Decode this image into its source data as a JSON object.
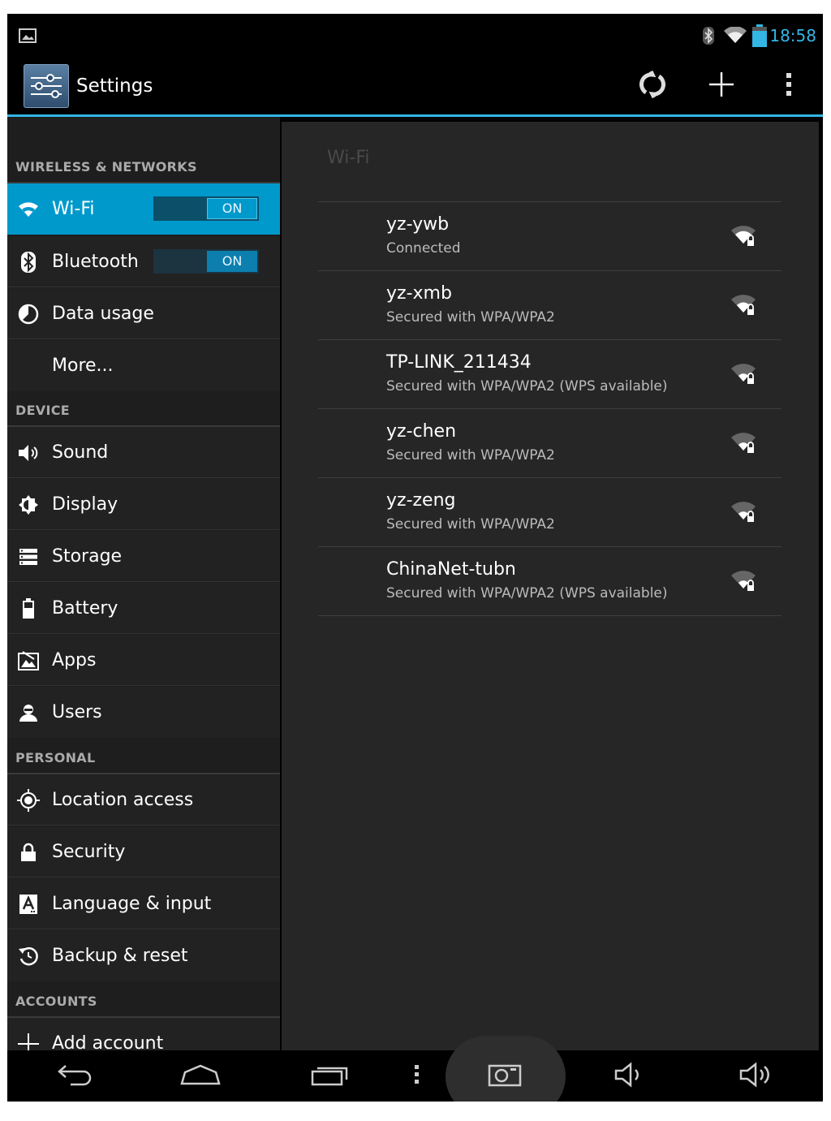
{
  "status_bar": {
    "time": "18:58"
  },
  "action_bar": {
    "title": "Settings"
  },
  "sidebar": {
    "sections": [
      {
        "header": "WIRELESS & NETWORKS"
      },
      {
        "header": "DEVICE"
      },
      {
        "header": "PERSONAL"
      },
      {
        "header": "ACCOUNTS"
      }
    ],
    "items": [
      {
        "label": "Wi-Fi",
        "toggle": "ON",
        "selected": true,
        "icon": "wifi-icon"
      },
      {
        "label": "Bluetooth",
        "toggle": "ON",
        "icon": "bluetooth-icon"
      },
      {
        "label": "Data usage",
        "icon": "data-usage-icon"
      },
      {
        "label": "More...",
        "icon": ""
      },
      {
        "label": "Sound",
        "icon": "speaker-icon"
      },
      {
        "label": "Display",
        "icon": "brightness-icon"
      },
      {
        "label": "Storage",
        "icon": "storage-icon"
      },
      {
        "label": "Battery",
        "icon": "battery-icon"
      },
      {
        "label": "Apps",
        "icon": "apps-icon"
      },
      {
        "label": "Users",
        "icon": "user-icon"
      },
      {
        "label": "Location access",
        "icon": "location-icon"
      },
      {
        "label": "Security",
        "icon": "lock-icon"
      },
      {
        "label": "Language & input",
        "icon": "language-icon"
      },
      {
        "label": "Backup & reset",
        "icon": "backup-icon"
      },
      {
        "label": "Add account",
        "icon": "plus-icon"
      }
    ]
  },
  "wifi_panel": {
    "title": "Wi-Fi",
    "networks": [
      {
        "ssid": "yz-ywb",
        "status": "Connected"
      },
      {
        "ssid": "yz-xmb",
        "status": "Secured with WPA/WPA2"
      },
      {
        "ssid": "TP-LINK_211434",
        "status": "Secured with WPA/WPA2 (WPS available)"
      },
      {
        "ssid": "yz-chen",
        "status": "Secured with WPA/WPA2"
      },
      {
        "ssid": "yz-zeng",
        "status": "Secured with WPA/WPA2"
      },
      {
        "ssid": "ChinaNet-tubn",
        "status": "Secured with WPA/WPA2 (WPS available)"
      }
    ]
  },
  "colors": {
    "accent": "#33b5e5",
    "selected": "#0099cc"
  }
}
